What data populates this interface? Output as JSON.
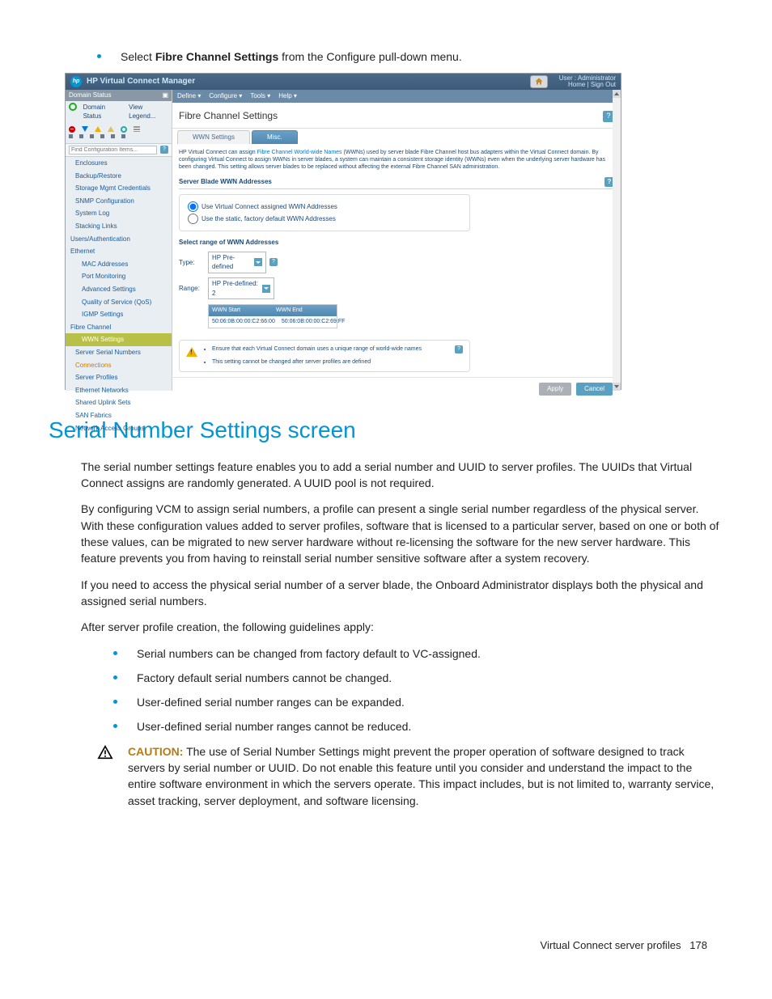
{
  "intro_bullet_pre": "Select ",
  "intro_bullet_bold": "Fibre Channel Settings",
  "intro_bullet_post": " from the Configure pull-down menu.",
  "app": {
    "logo": "hp",
    "title": "HP Virtual Connect Manager",
    "user_line1": "User : Administrator",
    "user_line2": "Home | Sign Out",
    "menus": [
      "Define ▾",
      "Configure ▾",
      "Tools ▾",
      "Help ▾"
    ],
    "domain_status": "Domain Status",
    "domain_link": "Domain Status",
    "legend_link": "View Legend...",
    "find_placeholder": "Find Configuration Items...",
    "nav": {
      "enclosures": "Enclosures",
      "backup": "Backup/Restore",
      "storage": "Storage Mgmt Credentials",
      "snmp": "SNMP Configuration",
      "syslog": "System Log",
      "stacking": "Stacking Links",
      "users": "Users/Authentication",
      "ethernet": "Ethernet",
      "mac": "MAC Addresses",
      "portmon": "Port Monitoring",
      "adv": "Advanced Settings",
      "qos": "Quality of Service (QoS)",
      "igmp": "IGMP Settings",
      "fc": "Fibre Channel",
      "wwn": "WWN Settings",
      "serial": "Server Serial Numbers",
      "connections": "Connections",
      "profiles": "Server Profiles",
      "ethnet": "Ethernet Networks",
      "uplink": "Shared Uplink Sets",
      "san": "SAN Fabrics",
      "nag": "Network Access Groups"
    },
    "page_title": "Fibre Channel Settings",
    "tab1": "WWN Settings",
    "tab2": "Misc.",
    "desc_pre": "HP Virtual Connect can assign ",
    "desc_link": "Fibre Channel World-wide Names",
    "desc_post": " (WWNs) used by server blade Fibre Channel host bus adapters within the Virtual Connect domain. By configuring Virtual Connect to assign WWNs in server blades, a system can maintain a consistent storage identity (WWNs) even when the underlying server hardware has been changed. This setting allows server blades to be replaced without affecting the external Fibre Channel SAN administration.",
    "sec1": "Server Blade WWN Addresses",
    "radio1": "Use Virtual Connect assigned WWN Addresses",
    "radio2": "Use the static, factory default WWN Addresses",
    "sec2": "Select range of WWN Addresses",
    "label_type": "Type:",
    "type_value": "HP Pre-defined",
    "label_range": "Range:",
    "range_value": "HP Pre-defined: 2",
    "th1": "WWN Start",
    "th2": "WWN End",
    "td1": "50:06:0B:00:00:C2:66:00",
    "td2": "50:06:0B:00:00:C2:69:FF",
    "note1": "Ensure that each Virtual Connect domain uses a unique range of world-wide names",
    "note2": "This setting cannot be changed after server profiles are defined",
    "apply": "Apply",
    "cancel": "Cancel"
  },
  "section_title": "Serial Number Settings screen",
  "p1": "The serial number settings feature enables you to add a serial number and UUID to server profiles. The UUIDs that Virtual Connect assigns are randomly generated. A UUID pool is not required.",
  "p2": "By configuring VCM to assign serial numbers, a profile can present a single serial number regardless of the physical server. With these configuration values added to server profiles, software that is licensed to a particular server, based on one or both of these values, can be migrated to new server hardware without re-licensing the software for the new server hardware. This feature prevents you from having to reinstall serial number sensitive software after a system recovery.",
  "p3": "If you need to access the physical serial number of a server blade, the Onboard Administrator displays both the physical and assigned serial numbers.",
  "p4": "After server profile creation, the following guidelines apply:",
  "bul": [
    "Serial numbers can be changed from factory default to VC-assigned.",
    "Factory default serial numbers cannot be changed.",
    "User-defined serial number ranges can be expanded.",
    "User-defined serial number ranges cannot be reduced."
  ],
  "caution_label": "CAUTION:",
  "caution_body": "  The use of Serial Number Settings might prevent the proper operation of software designed to track servers by serial number or UUID. Do not enable this feature until you consider and understand the impact to the entire software environment in which the servers operate. This impact includes, but is not limited to, warranty service, asset tracking, server deployment, and software licensing.",
  "footer_text": "Virtual Connect server profiles",
  "footer_page": "178"
}
